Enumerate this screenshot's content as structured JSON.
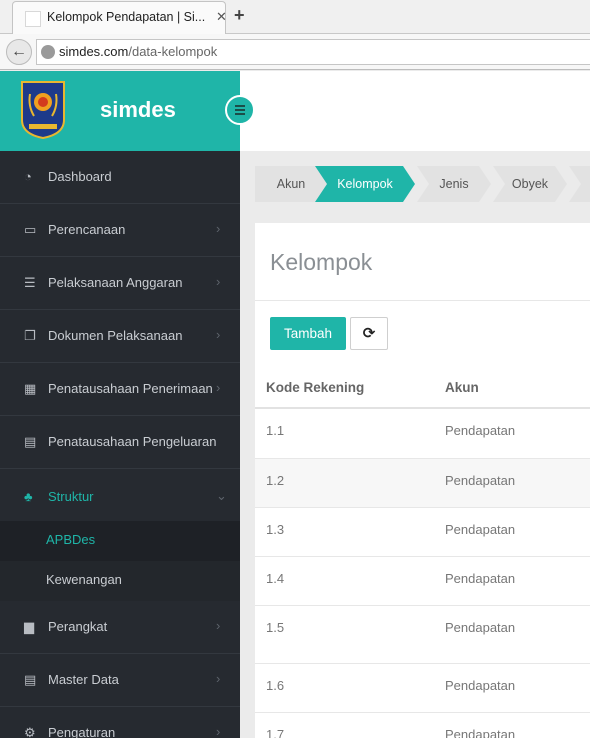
{
  "browser": {
    "tab_title": "Kelompok Pendapatan | Si...",
    "tab_close": "✕",
    "new_tab": "+",
    "url_domain": "simdes.com",
    "url_path": "/data-kelompok"
  },
  "brand": {
    "name": "simdes"
  },
  "sidebar": {
    "items": [
      {
        "label": "Dashboard",
        "icon": "dashboard-icon",
        "glyph": "◔",
        "chevron": false
      },
      {
        "label": "Perencanaan",
        "icon": "credit-card-icon",
        "glyph": "▭",
        "chevron": true
      },
      {
        "label": "Pelaksanaan Anggaran",
        "icon": "list-icon",
        "glyph": "☰",
        "chevron": true
      },
      {
        "label": "Dokumen Pelaksanaan",
        "icon": "copy-icon",
        "glyph": "❐",
        "chevron": true
      },
      {
        "label": "Penatausahaan Penerimaan",
        "icon": "table-icon",
        "glyph": "▦",
        "chevron": true
      },
      {
        "label": "Penatausahaan Pengeluaran",
        "icon": "list-alt-icon",
        "glyph": "▤",
        "chevron": false
      },
      {
        "label": "Struktur",
        "icon": "sitemap-icon",
        "glyph": "♣",
        "chevron": true,
        "active": true
      },
      {
        "label": "Perangkat",
        "icon": "briefcase-icon",
        "glyph": "▆",
        "chevron": true
      },
      {
        "label": "Master Data",
        "icon": "list-alt-icon",
        "glyph": "▤",
        "chevron": true
      },
      {
        "label": "Pengaturan",
        "icon": "gear-icon",
        "glyph": "⚙",
        "chevron": true
      }
    ],
    "subitems": [
      {
        "label": "APBDes",
        "current": true
      },
      {
        "label": "Kewenangan",
        "current": false
      }
    ]
  },
  "breadcrumb": [
    {
      "label": "Akun",
      "active": false
    },
    {
      "label": "Kelompok",
      "active": true
    },
    {
      "label": "Jenis",
      "active": false
    },
    {
      "label": "Obyek",
      "active": false
    }
  ],
  "panel": {
    "title": "Kelompok",
    "add_label": "Tambah",
    "refresh_glyph": "⟳"
  },
  "table": {
    "headers": [
      "Kode Rekening",
      "Akun"
    ],
    "rows": [
      {
        "kode": "1.1",
        "akun": "Pendapatan"
      },
      {
        "kode": "1.2",
        "akun": "Pendapatan"
      },
      {
        "kode": "1.3",
        "akun": "Pendapatan"
      },
      {
        "kode": "1.4",
        "akun": "Pendapatan"
      },
      {
        "kode": "1.5",
        "akun": "Pendapatan"
      },
      {
        "kode": "1.6",
        "akun": "Pendapatan"
      },
      {
        "kode": "1.7",
        "akun": "Pendapatan"
      }
    ]
  },
  "colors": {
    "accent": "#1fb5a8",
    "sidebar": "#262a30"
  }
}
